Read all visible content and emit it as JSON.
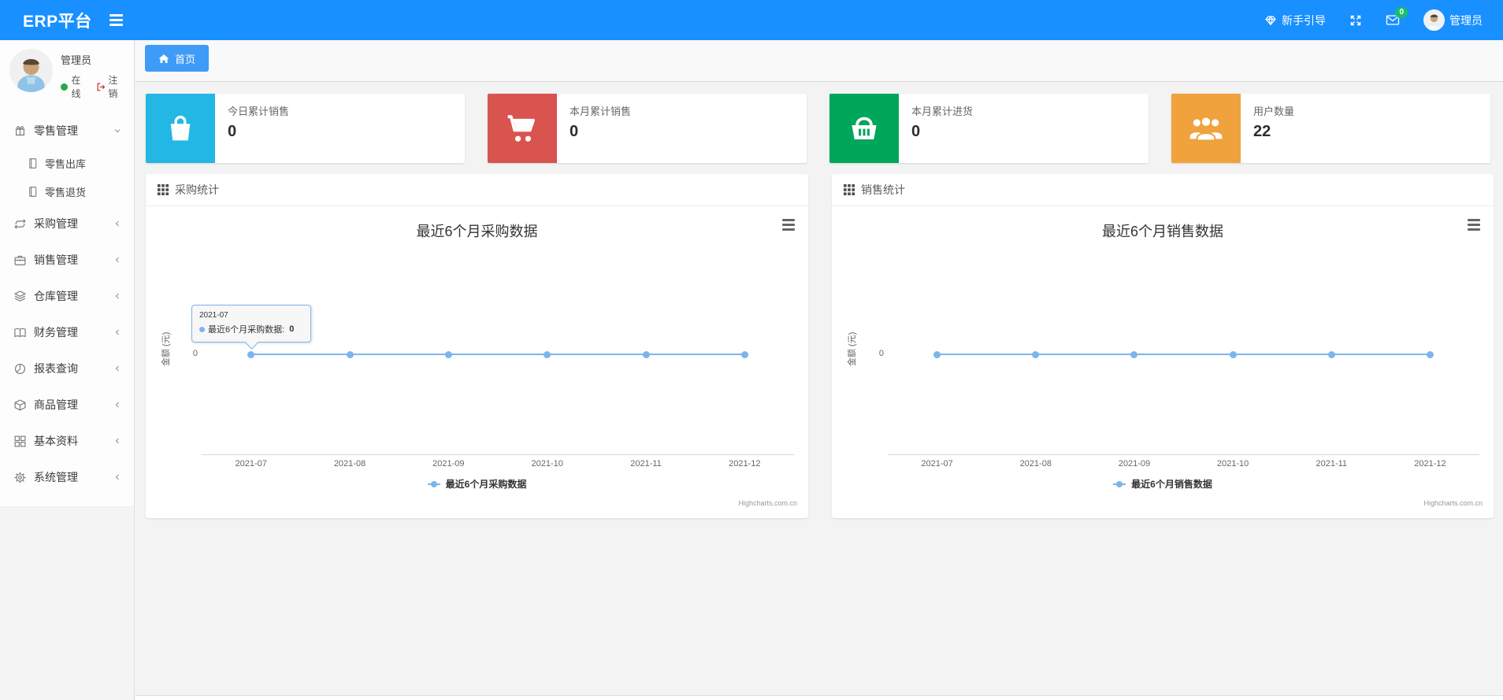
{
  "navbar": {
    "brand": "ERP平台",
    "guide_label": "新手引导",
    "mail_badge": "0",
    "username": "管理员"
  },
  "sidebar": {
    "user": {
      "name": "管理员",
      "status": "在线",
      "logout": "注销"
    },
    "menu": [
      {
        "label": "零售管理",
        "icon": "gift-icon",
        "expanded": true,
        "children": [
          {
            "label": "零售出库"
          },
          {
            "label": "零售退货"
          }
        ]
      },
      {
        "label": "采购管理",
        "icon": "repeat-icon"
      },
      {
        "label": "销售管理",
        "icon": "briefcase-icon"
      },
      {
        "label": "仓库管理",
        "icon": "layers-icon"
      },
      {
        "label": "财务管理",
        "icon": "ledger-icon"
      },
      {
        "label": "报表查询",
        "icon": "report-icon"
      },
      {
        "label": "商品管理",
        "icon": "cube-icon"
      },
      {
        "label": "基本资料",
        "icon": "grid-icon"
      },
      {
        "label": "系统管理",
        "icon": "gear-icon"
      }
    ]
  },
  "tabs": {
    "home": "首页"
  },
  "stat_cards": [
    {
      "label": "今日累计销售",
      "value": "0",
      "color": "#23b7e5",
      "icon": "bag-icon"
    },
    {
      "label": "本月累计销售",
      "value": "0",
      "color": "#d9534f",
      "icon": "cart-icon"
    },
    {
      "label": "本月累计进货",
      "value": "0",
      "color": "#00a65a",
      "icon": "basket-icon"
    },
    {
      "label": "用户数量",
      "value": "22",
      "color": "#f0a23c",
      "icon": "users-icon"
    }
  ],
  "panels": [
    {
      "title": "采购统计"
    },
    {
      "title": "销售统计"
    }
  ],
  "chart_data": [
    {
      "type": "line",
      "title": "最近6个月采购数据",
      "x": [
        "2021-07",
        "2021-08",
        "2021-09",
        "2021-10",
        "2021-11",
        "2021-12"
      ],
      "series": [
        {
          "name": "最近6个月采购数据",
          "values": [
            0,
            0,
            0,
            0,
            0,
            0
          ]
        }
      ],
      "ylabel": "金额 (元)",
      "y_tick": "0",
      "grid": false,
      "legend_position": "bottom",
      "line_color": "#7cb5ec",
      "credits": "Highcharts.com.cn",
      "tooltip": {
        "header": "2021-07",
        "label": "最近6个月采购数据:",
        "value": "0"
      }
    },
    {
      "type": "line",
      "title": "最近6个月销售数据",
      "x": [
        "2021-07",
        "2021-08",
        "2021-09",
        "2021-10",
        "2021-11",
        "2021-12"
      ],
      "series": [
        {
          "name": "最近6个月销售数据",
          "values": [
            0,
            0,
            0,
            0,
            0,
            0
          ]
        }
      ],
      "ylabel": "金额 (元)",
      "y_tick": "0",
      "grid": false,
      "legend_position": "bottom",
      "line_color": "#7cb5ec",
      "credits": "Highcharts.com.cn"
    }
  ]
}
